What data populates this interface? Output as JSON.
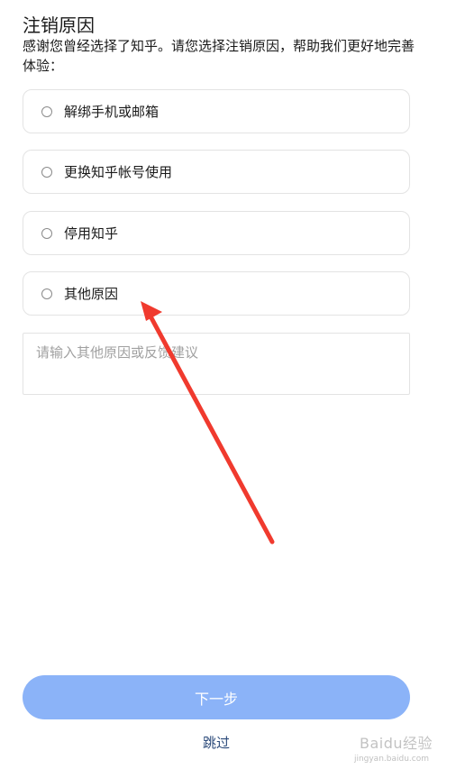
{
  "header": {
    "title": "注销原因",
    "subtitle": "感谢您曾经选择了知乎。请您选择注销原因，帮助我们更好地完善体验："
  },
  "options": [
    {
      "label": "解绑手机或邮箱",
      "selected": false
    },
    {
      "label": "更换知乎帐号使用",
      "selected": false
    },
    {
      "label": "停用知乎",
      "selected": false
    },
    {
      "label": "其他原因",
      "selected": false
    }
  ],
  "feedback": {
    "placeholder": "请输入其他原因或反馈建议",
    "value": ""
  },
  "actions": {
    "next_label": "下一步",
    "skip_label": "跳过"
  },
  "watermark": {
    "text": "Baidu经验",
    "sub": "jingyan.baidu.com"
  },
  "colors": {
    "primary_button": "#8bb3f8",
    "skip_link": "#2b4a7a",
    "annotation_arrow": "#f03a2e"
  }
}
